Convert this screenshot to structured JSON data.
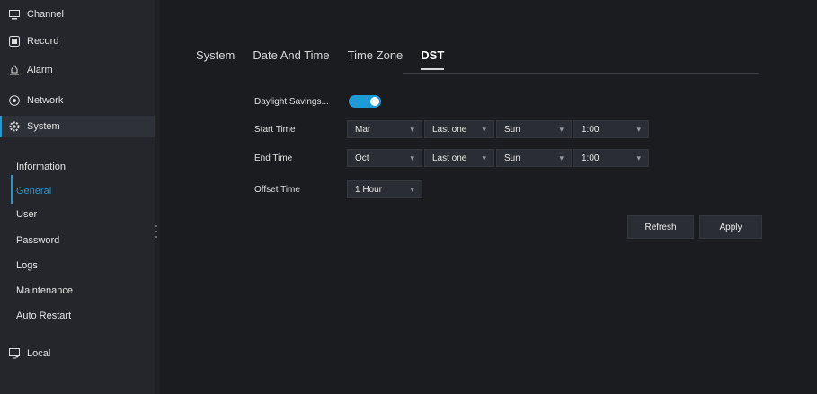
{
  "sidebar": {
    "top_items": [
      {
        "label": "Channel",
        "icon": "monitor-icon"
      },
      {
        "label": "Record",
        "icon": "record-icon"
      },
      {
        "label": "Alarm",
        "icon": "alarm-icon"
      },
      {
        "label": "Network",
        "icon": "network-icon"
      },
      {
        "label": "System",
        "icon": "gear-icon"
      }
    ],
    "sub_items": [
      "Information",
      "General",
      "User",
      "Password",
      "Logs",
      "Maintenance",
      "Auto Restart"
    ],
    "active_sub": "General",
    "bottom_item": {
      "label": "Local",
      "icon": "local-icon"
    }
  },
  "tabs": [
    "System",
    "Date And Time",
    "Time Zone",
    "DST"
  ],
  "active_tab": "DST",
  "form": {
    "daylight_label": "Daylight Savings...",
    "daylight_on": true,
    "start_label": "Start Time",
    "start": {
      "month": "Mar",
      "week": "Last one",
      "day": "Sun",
      "time": "1:00"
    },
    "end_label": "End Time",
    "end": {
      "month": "Oct",
      "week": "Last one",
      "day": "Sun",
      "time": "1:00"
    },
    "offset_label": "Offset Time",
    "offset": "1 Hour"
  },
  "buttons": {
    "refresh": "Refresh",
    "apply": "Apply"
  },
  "colors": {
    "accent": "#1e9ad6",
    "background": "#1a1c20",
    "sidebar": "#24262b"
  }
}
